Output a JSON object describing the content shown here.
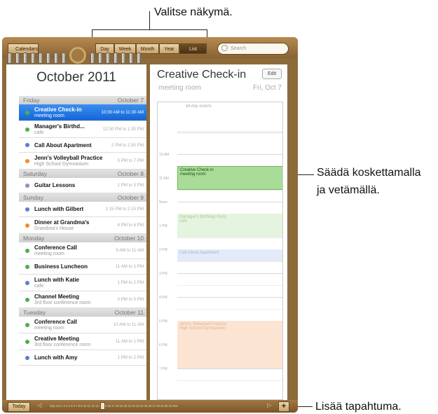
{
  "callouts": {
    "view": "Valitse näkymä.",
    "drag_line1": "Säädä koskettamalla",
    "drag_line2": "ja vetämällä.",
    "add": "Lisää tapahtuma."
  },
  "toolbar": {
    "calendars": "Calendars",
    "tabs": [
      "Day",
      "Week",
      "Month",
      "Year",
      "List"
    ],
    "active_tab": "List",
    "search_placeholder": "Search"
  },
  "list": {
    "month_title": "October 2011",
    "days": [
      {
        "name": "Friday",
        "date": "October 7"
      },
      {
        "name": "Saturday",
        "date": "October 8"
      },
      {
        "name": "Sunday",
        "date": "October 9"
      },
      {
        "name": "Monday",
        "date": "October 10"
      },
      {
        "name": "Tuesday",
        "date": "October 11"
      }
    ],
    "events": [
      {
        "title": "Creative Check-in",
        "sub": "meeting room",
        "time": "10:30 AM to 11:30 AM",
        "color": "#4ab04a"
      },
      {
        "title": "Manager's Birthd...",
        "sub": "cafe",
        "time": "12:30 PM to 1:30 PM",
        "color": "#4ab04a"
      },
      {
        "title": "Call About Apartment",
        "sub": "",
        "time": "2 PM to 2:30 PM",
        "color": "#5a7fd0"
      },
      {
        "title": "Jenn's Volleyball Practice",
        "sub": "High School Gymnasium",
        "time": "5 PM to 7 PM",
        "color": "#f08c30"
      },
      {
        "title": "Guitar Lessons",
        "sub": "",
        "time": "1 PM to 3 PM",
        "color": "#9a86c8"
      },
      {
        "title": "Lunch with Gilbert",
        "sub": "",
        "time": "1:15 PM to 2:15 PM",
        "color": "#5a7fd0"
      },
      {
        "title": "Dinner at Grandma's",
        "sub": "Grandma's House",
        "time": "4 PM to 6 PM",
        "color": "#f08c30"
      },
      {
        "title": "Conference Call",
        "sub": "meeting room",
        "time": "9 AM to 11 AM",
        "color": "#4ab04a"
      },
      {
        "title": "Business Luncheon",
        "sub": "",
        "time": "11 AM to 1 PM",
        "color": "#4ab04a"
      },
      {
        "title": "Lunch with Katie",
        "sub": "cafe",
        "time": "1 PM to 2 PM",
        "color": "#5a7fd0"
      },
      {
        "title": "Channel Meeting",
        "sub": "3rd floor conference room",
        "time": "3 PM to 5 PM",
        "color": "#4ab04a"
      },
      {
        "title": "Conference Call",
        "sub": "meeting room",
        "time": "10 AM to 11 AM",
        "color": "#4ab04a"
      },
      {
        "title": "Creative Meeting",
        "sub": "3rd floor conference room",
        "time": "11 AM to 1 PM",
        "color": "#4ab04a"
      },
      {
        "title": "Lunch with Amy",
        "sub": "",
        "time": "1 PM to 2 PM",
        "color": "#5a7fd0"
      }
    ]
  },
  "detail": {
    "title": "Creative Check-in",
    "edit": "Edit",
    "location": "meeting room",
    "date": "Fri, Oct 7",
    "all_day": "all-day events",
    "hours": [
      "10 AM",
      "11 AM",
      "Noon",
      "1 PM",
      "2 PM",
      "3 PM",
      "4 PM",
      "5 PM",
      "6 PM",
      "7 PM"
    ],
    "blocks": [
      {
        "title": "Creative Check-in",
        "sub": "meeting room"
      },
      {
        "title": "Manager's Birthday Party",
        "sub": "cafe"
      },
      {
        "title": "Call About Apartment",
        "sub": ""
      },
      {
        "title": "Jenn's Volleyball Practice",
        "sub": "High School Gymnasium"
      }
    ]
  },
  "bottom": {
    "today": "Today",
    "timeline": "Sep  Oct 1 2 3 4 5 6 7 8 9 10 11 12 13 14 15 16 17 18 19 20 21 22 23 24 25 26 27 28 29 30 31  Nov",
    "add": "+"
  }
}
